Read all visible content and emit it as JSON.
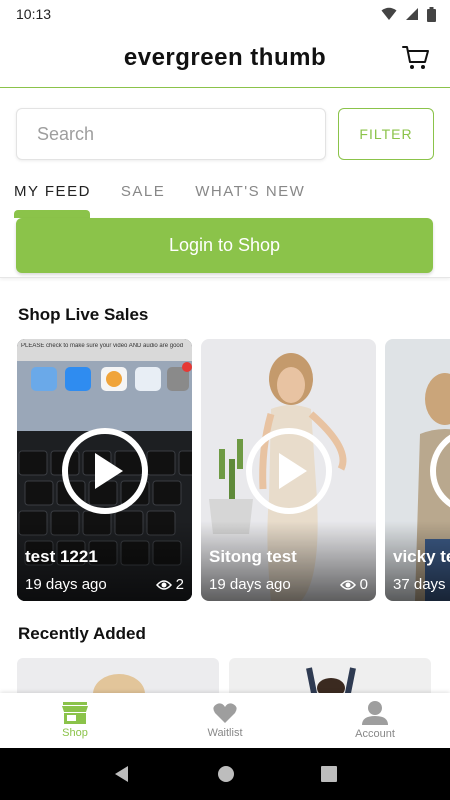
{
  "status_bar": {
    "time": "10:13"
  },
  "header": {
    "title": "evergreen thumb"
  },
  "search": {
    "placeholder": "Search",
    "filter_label": "FILTER"
  },
  "tabs": [
    {
      "label": "MY FEED",
      "active": true
    },
    {
      "label": "SALE",
      "active": false
    },
    {
      "label": "WHAT'S NEW",
      "active": false
    }
  ],
  "login": {
    "label": "Login to Shop"
  },
  "live_sales": {
    "title": "Shop Live Sales",
    "cards": [
      {
        "title": "test 1221",
        "time": "19 days ago",
        "views": "2",
        "card_notice": "PLEASE check to make sure your video AND audio are good"
      },
      {
        "title": "Sitong test",
        "time": "19 days ago",
        "views": "0"
      },
      {
        "title": "vicky te",
        "time": "37 days"
      }
    ]
  },
  "recently_added": {
    "title": "Recently Added"
  },
  "bottom_nav": [
    {
      "label": "Shop",
      "icon": "store-icon",
      "active": true
    },
    {
      "label": "Waitlist",
      "icon": "heart-icon",
      "active": false
    },
    {
      "label": "Account",
      "icon": "person-icon",
      "active": false
    }
  ],
  "colors": {
    "accent": "#8bc34a"
  }
}
